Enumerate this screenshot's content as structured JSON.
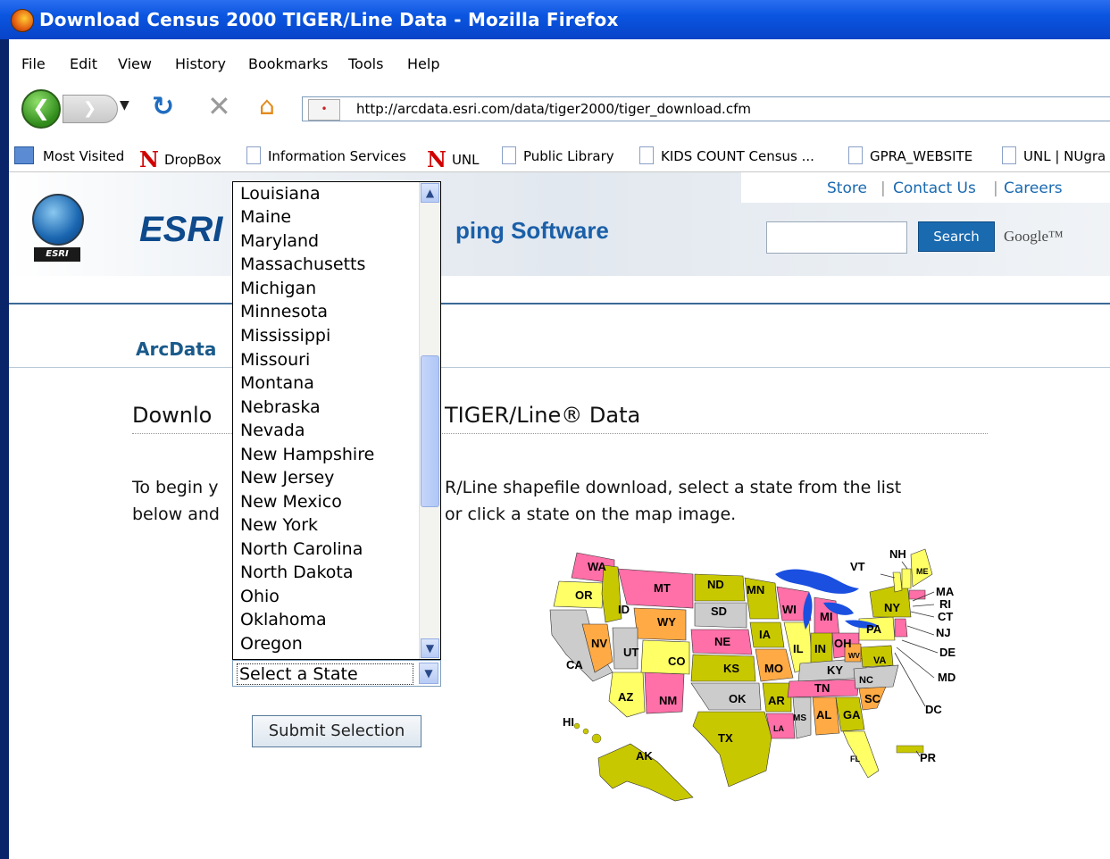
{
  "window": {
    "title": "Download Census 2000 TIGER/Line Data - Mozilla Firefox"
  },
  "menu": [
    "File",
    "Edit",
    "View",
    "History",
    "Bookmarks",
    "Tools",
    "Help"
  ],
  "nav": {
    "url": "http://arcdata.esri.com/data/tiger2000/tiger_download.cfm"
  },
  "bookmarks": [
    {
      "label": "Most Visited",
      "icon": "folder-icon"
    },
    {
      "label": "DropBox",
      "icon": "unl-n-icon"
    },
    {
      "label": "Information Services",
      "icon": "page-icon"
    },
    {
      "label": "UNL",
      "icon": "unl-n-icon"
    },
    {
      "label": "Public Library",
      "icon": "page-icon"
    },
    {
      "label": "KIDS COUNT Census ...",
      "icon": "page-icon"
    },
    {
      "label": "GPRA_WEBSITE",
      "icon": "page-icon"
    },
    {
      "label": "UNL | NUgra",
      "icon": "page-icon"
    }
  ],
  "header": {
    "brand": "ESRI",
    "logo_tag": "ESRI",
    "tagline": "ping Software",
    "links": [
      "Store",
      "Contact Us",
      "Careers"
    ],
    "search_button": "Search",
    "google": "Google™"
  },
  "section": "ArcData",
  "page": {
    "heading_left": "Downlo",
    "heading_right": "TIGER/Line® Data",
    "intro_left_1": "To begin y",
    "intro_left_2": "below and",
    "intro_right_1": "R/Line shapefile download, select a state from the list",
    "intro_right_2": "or click a state on the map image."
  },
  "form": {
    "selected": "Select a State",
    "submit": "Submit Selection",
    "options_visible": [
      "Louisiana",
      "Maine",
      "Maryland",
      "Massachusetts",
      "Michigan",
      "Minnesota",
      "Mississippi",
      "Missouri",
      "Montana",
      "Nebraska",
      "Nevada",
      "New Hampshire",
      "New Jersey",
      "New Mexico",
      "New York",
      "North Carolina",
      "North Dakota",
      "Ohio",
      "Oklahoma",
      "Oregon"
    ]
  },
  "map": {
    "labels": [
      "WA",
      "OR",
      "CA",
      "ID",
      "NV",
      "MT",
      "WY",
      "UT",
      "AZ",
      "ND",
      "SD",
      "NE",
      "CO",
      "NM",
      "KS",
      "OK",
      "TX",
      "MN",
      "IA",
      "MO",
      "AR",
      "LA",
      "WI",
      "IL",
      "MI",
      "IN",
      "OH",
      "KY",
      "TN",
      "MS",
      "AL",
      "GA",
      "FL",
      "SC",
      "NC",
      "VA",
      "WV",
      "PA",
      "NY",
      "VT",
      "NH",
      "ME",
      "MA",
      "RI",
      "CT",
      "NJ",
      "DE",
      "MD",
      "DC",
      "AK",
      "HI",
      "PR"
    ]
  }
}
